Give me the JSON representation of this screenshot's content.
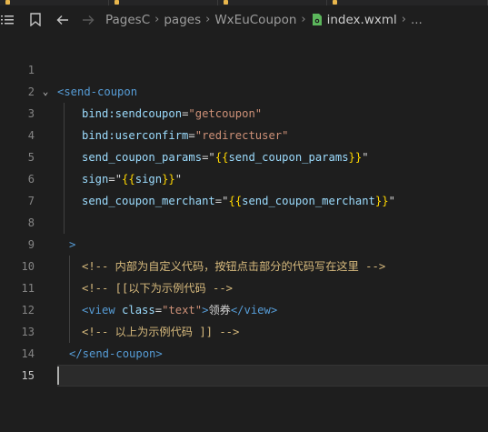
{
  "toolbar": {
    "breadcrumbs": [
      "PagesC",
      "pages",
      "WxEuCoupon"
    ],
    "file_name": "index.wxml",
    "trailing": "..."
  },
  "editor": {
    "current_line": 15,
    "lines": [
      {
        "num": "1",
        "segments": []
      },
      {
        "num": "2",
        "fold": "⌄",
        "segments": [
          {
            "c": "t-tag",
            "t": "<send-coupon"
          }
        ]
      },
      {
        "num": "3",
        "segments": [
          {
            "c": "t-attr",
            "t": "bind:sendcoupon"
          },
          {
            "c": "t-text",
            "t": "="
          },
          {
            "c": "t-str",
            "t": "\"getcoupon\""
          }
        ]
      },
      {
        "num": "4",
        "segments": [
          {
            "c": "t-attr",
            "t": "bind:userconfirm"
          },
          {
            "c": "t-text",
            "t": "="
          },
          {
            "c": "t-str",
            "t": "\"redirectuser\""
          }
        ]
      },
      {
        "num": "5",
        "segments": [
          {
            "c": "t-attr",
            "t": "send_coupon_params"
          },
          {
            "c": "t-text",
            "t": "="
          },
          {
            "c": "t-text",
            "t": "\""
          },
          {
            "c": "t-brace",
            "t": "{{"
          },
          {
            "c": "t-attr",
            "t": "send_coupon_params"
          },
          {
            "c": "t-brace",
            "t": "}}"
          },
          {
            "c": "t-text",
            "t": "\""
          }
        ]
      },
      {
        "num": "6",
        "segments": [
          {
            "c": "t-attr",
            "t": "sign"
          },
          {
            "c": "t-text",
            "t": "="
          },
          {
            "c": "t-text",
            "t": "\""
          },
          {
            "c": "t-brace",
            "t": "{{"
          },
          {
            "c": "t-attr",
            "t": "sign"
          },
          {
            "c": "t-brace",
            "t": "}}"
          },
          {
            "c": "t-text",
            "t": "\""
          }
        ]
      },
      {
        "num": "7",
        "segments": [
          {
            "c": "t-attr",
            "t": "send_coupon_merchant"
          },
          {
            "c": "t-text",
            "t": "="
          },
          {
            "c": "t-text",
            "t": "\""
          },
          {
            "c": "t-brace",
            "t": "{{"
          },
          {
            "c": "t-attr",
            "t": "send_coupon_merchant"
          },
          {
            "c": "t-brace",
            "t": "}}"
          },
          {
            "c": "t-text",
            "t": "\""
          }
        ]
      },
      {
        "num": "8",
        "segments": []
      },
      {
        "num": "9",
        "segments": [
          {
            "c": "t-tag",
            "t": ">"
          }
        ]
      },
      {
        "num": "10",
        "segments": [
          {
            "c": "t-comment-yellow",
            "t": "<!-- 内部为自定义代码，按钮点击部分的代码写在这里 -->"
          }
        ]
      },
      {
        "num": "11",
        "segments": [
          {
            "c": "t-comment-yellow",
            "t": "<!-- [[以下为示例代码 -->"
          }
        ]
      },
      {
        "num": "12",
        "segments": [
          {
            "c": "t-tag",
            "t": "<view "
          },
          {
            "c": "t-attr",
            "t": "class"
          },
          {
            "c": "t-text",
            "t": "="
          },
          {
            "c": "t-str",
            "t": "\"text\""
          },
          {
            "c": "t-tag",
            "t": ">"
          },
          {
            "c": "t-text",
            "t": "领券"
          },
          {
            "c": "t-tag",
            "t": "</view>"
          }
        ]
      },
      {
        "num": "13",
        "segments": [
          {
            "c": "t-comment-yellow",
            "t": "<!-- 以上为示例代码 ]] -->"
          }
        ]
      },
      {
        "num": "14",
        "segments": [
          {
            "c": "t-tag",
            "t": "</send-coupon>"
          }
        ]
      },
      {
        "num": "15",
        "segments": []
      }
    ]
  }
}
